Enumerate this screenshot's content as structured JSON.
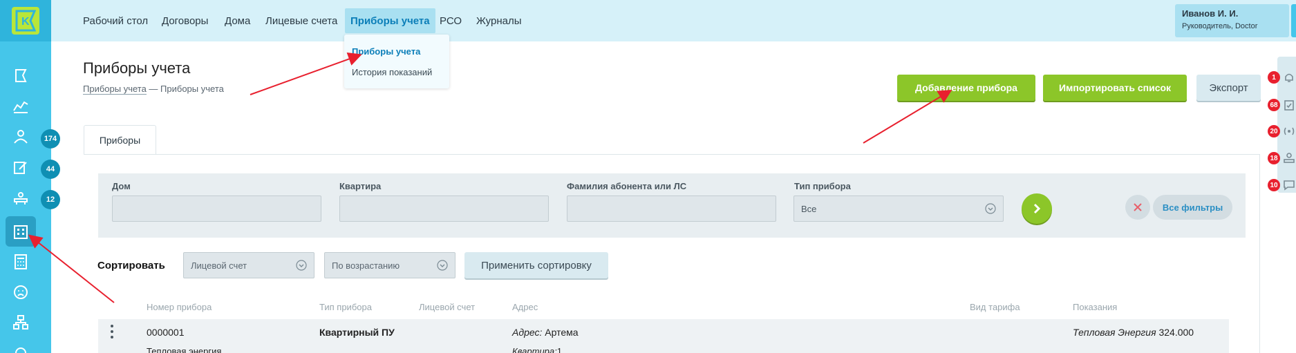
{
  "colors": {
    "sidebar": "#45c6ea",
    "topbar": "#d6f1f9",
    "accent_green": "#8cc629",
    "badge_red": "#e8202e",
    "arrow_red": "#e8202e"
  },
  "nav": {
    "items": [
      "Рабочий стол",
      "Договоры",
      "Дома",
      "Лицевые счета",
      "Приборы учета",
      "РСО",
      "Журналы"
    ],
    "active": "Приборы учета",
    "dropdown": [
      "Приборы учета",
      "История показаний"
    ]
  },
  "user": {
    "name": "Иванов И. И.",
    "role": "Руководитель, Doctor"
  },
  "sidebar": {
    "logo_letter": "K",
    "badges": [
      "174",
      "44",
      "12"
    ],
    "icons": [
      "flag-icon",
      "chart-icon",
      "people-icon",
      "edit-icon",
      "desk-icon",
      "building-icon",
      "calculator-icon",
      "sad-face-icon",
      "org-icon"
    ]
  },
  "page": {
    "title": "Приборы учета",
    "breadcrumb_link": "Приборы учета",
    "breadcrumb_sep": " — ",
    "breadcrumb_current": "Приборы учета"
  },
  "actions": {
    "add": "Добавление прибора",
    "import": "Импортировать список",
    "export": "Экспорт"
  },
  "notifications": {
    "badges": [
      "1",
      "68",
      "20",
      "18",
      "10"
    ]
  },
  "tab": {
    "label": "Приборы"
  },
  "filters": {
    "house": "Дом",
    "apartment": "Квартира",
    "subscriber": "Фамилия абонента или ЛС",
    "device_type": "Тип прибора",
    "device_type_value": "Все",
    "all_filters": "Все фильтры"
  },
  "sort": {
    "label": "Сортировать",
    "field": "Лицевой счет",
    "order": "По возрастанию",
    "apply": "Применить сортировку"
  },
  "table": {
    "headers": [
      "Номер прибора",
      "Тип прибора",
      "Лицевой счет",
      "Адрес",
      "Вид тарифа",
      "Показания"
    ],
    "row": {
      "number": "0000001",
      "type": "Квартирный ПУ",
      "address_label": "Адрес:",
      "address_value": "Артема",
      "reading_label": "Тепловая Энергия",
      "reading_value": "324.000",
      "sub_left": "Тепловая энергия",
      "sub_addr_label": "Квартира:",
      "sub_addr_value": "1"
    }
  }
}
